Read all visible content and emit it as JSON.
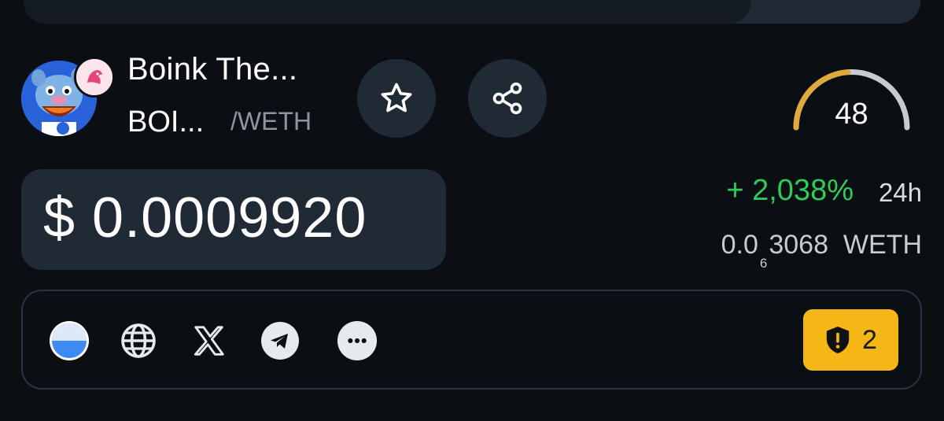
{
  "token": {
    "name": "Boink The...",
    "symbol": "BOI...",
    "quote": "/WETH",
    "avatar_icon": "pig-mascot-icon",
    "dex_badge_icon": "uniswap-unicorn-icon"
  },
  "actions": {
    "favorite_icon": "star-icon",
    "share_icon": "share-icon"
  },
  "score": {
    "value": "48",
    "fill_fraction": 0.48,
    "fill_color": "#e0a93b",
    "track_color": "#c6cbd2"
  },
  "price": {
    "usd": "$ 0.0009920",
    "change": "+ 2,038%",
    "change_color": "#2ecc5a",
    "period": "24h",
    "native_prefix": "0.0",
    "native_subscript": "6",
    "native_digits": "3068",
    "native_unit": "WETH"
  },
  "links": {
    "items": [
      {
        "icon": "progress-circle-icon"
      },
      {
        "icon": "globe-icon"
      },
      {
        "icon": "x-logo-icon"
      },
      {
        "icon": "telegram-icon"
      },
      {
        "icon": "more-icon"
      }
    ],
    "audit_count": "2",
    "audit_color": "#f5b616",
    "audit_icon": "shield-warning-icon"
  }
}
